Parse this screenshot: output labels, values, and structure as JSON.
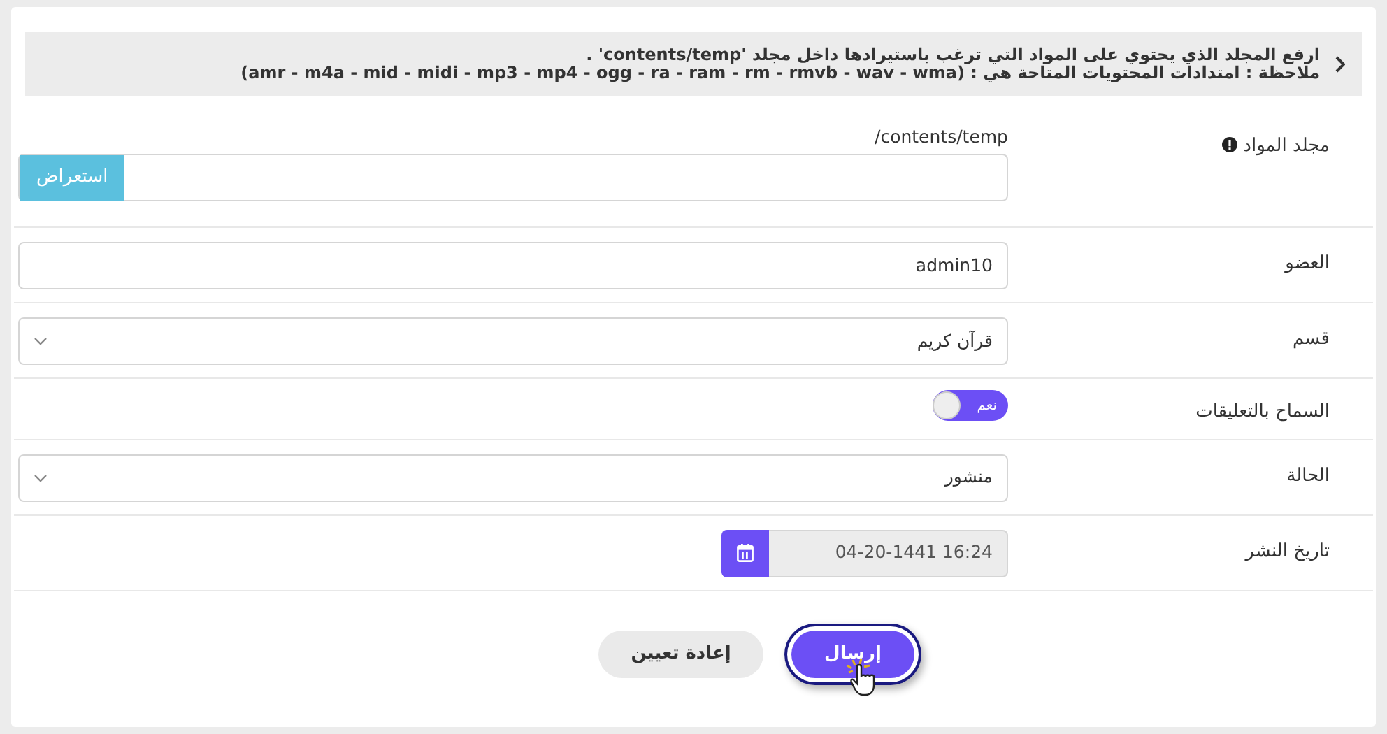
{
  "notice": {
    "lines": [
      "ارفع المجلد الذي يحتوي على المواد التي ترغب باستيرادها داخل مجلد 'contents/temp' .",
      "ملاحظة : امتدادات المحتويات المتاحة هي : (amr - m4a - mid - midi - mp3 - mp4 - ogg - ra - ram - rm - rmvb - wav - wma)"
    ]
  },
  "fields": [
    {
      "kind": "folder",
      "label": "مجلد المواد",
      "info": true,
      "hint": "/contents/temp",
      "button": "استعراض"
    },
    {
      "kind": "text",
      "label": "العضو",
      "value": "admin10"
    },
    {
      "kind": "select",
      "label": "قسم",
      "value": "قرآن كريم"
    },
    {
      "kind": "toggle",
      "label": "السماح بالتعليقات",
      "on": true,
      "text": "نعم"
    },
    {
      "kind": "select",
      "label": "الحالة",
      "value": "منشور"
    },
    {
      "kind": "date",
      "label": "تاريخ النشر",
      "value": "04-20-1441 16:24",
      "disabled": true
    }
  ],
  "buttons": [
    {
      "kind": "submit",
      "label": "إرسال"
    },
    {
      "kind": "reset",
      "label": "إعادة تعيين"
    }
  ]
}
